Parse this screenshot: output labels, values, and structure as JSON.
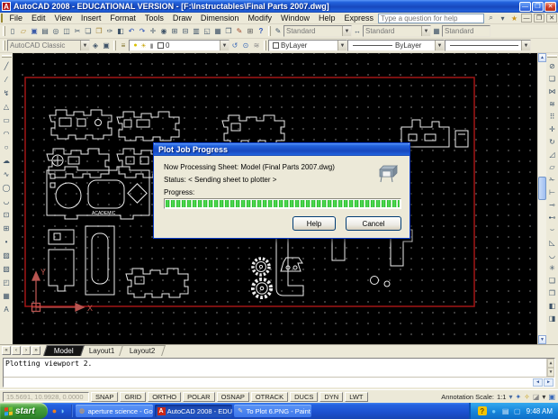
{
  "window": {
    "title": "AutoCAD 2008 - EDUCATIONAL VERSION - [F:\\Instructables\\Final Parts 2007.dwg]",
    "controls": {
      "minimize": "—",
      "restore": "❐",
      "close": "✕"
    }
  },
  "menubar": {
    "items": [
      "File",
      "Edit",
      "View",
      "Insert",
      "Format",
      "Tools",
      "Draw",
      "Dimension",
      "Modify",
      "Window",
      "Help",
      "Express"
    ],
    "help_placeholder": "Type a question for help",
    "icons": [
      {
        "n": "search-icon",
        "g": "⌕"
      },
      {
        "n": "search-dropdown-icon",
        "g": "▾"
      },
      {
        "n": "info-center-star-icon",
        "g": "★",
        "s": "color:#C89018"
      }
    ],
    "mdi": {
      "minimize": "—",
      "restore": "❐",
      "close": "✕"
    }
  },
  "toolbars": {
    "standard": [
      {
        "n": "qnew-icon",
        "g": "▯"
      },
      {
        "n": "open-icon",
        "g": "▱",
        "s": "color:#B08A28"
      },
      {
        "n": "save-icon",
        "g": "▣",
        "s": "color:#3A5AA8"
      },
      {
        "n": "plot-icon",
        "g": "▤"
      },
      {
        "n": "plot-preview-icon",
        "g": "◎"
      },
      {
        "n": "publish-icon",
        "g": "◫"
      },
      {
        "n": "cut-icon",
        "g": "✂"
      },
      {
        "n": "copy-icon",
        "g": "❏"
      },
      {
        "n": "paste-icon",
        "g": "❐",
        "s": "color:#A08030"
      },
      {
        "n": "match-properties-icon",
        "g": "✑"
      },
      {
        "n": "block-editor-icon",
        "g": "◧"
      },
      {
        "n": "undo-icon",
        "g": "↶",
        "s": "color:#2A52B8"
      },
      {
        "n": "redo-icon",
        "g": "↷",
        "s": "color:#2A52B8"
      },
      {
        "n": "pan-icon",
        "g": "✛"
      },
      {
        "n": "zoom-realtime-icon",
        "g": "◉"
      },
      {
        "n": "zoom-window-icon",
        "g": "⊞"
      },
      {
        "n": "zoom-previous-icon",
        "g": "⊟"
      },
      {
        "n": "properties-icon",
        "g": "▥"
      },
      {
        "n": "designcenter-icon",
        "g": "◱"
      },
      {
        "n": "tool-palettes-icon",
        "g": "▦"
      },
      {
        "n": "sheetset-manager-icon",
        "g": "❒"
      },
      {
        "n": "markup-icon",
        "g": "✎",
        "s": "color:#A04828"
      },
      {
        "n": "quickcalc-icon",
        "g": "⊞",
        "s": "color:#555"
      },
      {
        "n": "help-icon",
        "g": "?",
        "s": "color:#2A52B8;font-weight:bold"
      }
    ],
    "styles": {
      "text_style_value": "Standard",
      "dim_style_value": "Standard",
      "table_style_value": "Standard"
    },
    "style_icons": [
      {
        "n": "text-style-icon",
        "g": "✎"
      },
      {
        "n": "dim-style-icon",
        "g": "↔"
      },
      {
        "n": "table-style-icon",
        "g": "▦"
      }
    ],
    "workspace": {
      "value": "AutoCAD Classic"
    },
    "workspace_icons": [
      {
        "n": "workspace-settings-icon",
        "g": "◈"
      },
      {
        "n": "my-workspace-icon",
        "g": "▣"
      }
    ],
    "layers": {
      "properties_icon": {
        "n": "layer-properties-manager-icon",
        "g": "≡",
        "s": "color:#7A6A20"
      },
      "combo_icons": [
        {
          "n": "layer-on-bulb-icon",
          "g": "●",
          "s": "color:#D8C000"
        },
        {
          "n": "layer-freeze-sun-icon",
          "g": "☀",
          "s": "color:#C8A200"
        },
        {
          "n": "layer-lock-icon",
          "g": "▮",
          "s": "color:#8A8A8A"
        }
      ],
      "layer_value": "0",
      "after_icons": [
        {
          "n": "make-object-layer-current-icon",
          "g": "↺",
          "s": "color:#3A6AB8"
        },
        {
          "n": "layer-previous-icon",
          "g": "⊙",
          "s": "color:#3A6AB8"
        },
        {
          "n": "layer-states-icon",
          "g": "≋",
          "s": "color:#888"
        }
      ]
    },
    "properties": {
      "color_value": "ByLayer",
      "linetype_value": "ByLayer"
    }
  },
  "draw_toolbar": [
    {
      "n": "line-icon",
      "g": "╱"
    },
    {
      "n": "construction-line-icon",
      "g": "⁄"
    },
    {
      "n": "polyline-icon",
      "g": "↯"
    },
    {
      "n": "polygon-icon",
      "g": "△"
    },
    {
      "n": "rectangle-icon",
      "g": "▭"
    },
    {
      "n": "arc-icon",
      "g": "◠"
    },
    {
      "n": "circle-icon",
      "g": "○"
    },
    {
      "n": "revision-cloud-icon",
      "g": "☁"
    },
    {
      "n": "spline-icon",
      "g": "∿"
    },
    {
      "n": "ellipse-icon",
      "g": "◯"
    },
    {
      "n": "ellipse-arc-icon",
      "g": "◡"
    },
    {
      "n": "insert-block-icon",
      "g": "⊡"
    },
    {
      "n": "make-block-icon",
      "g": "⊞"
    },
    {
      "n": "point-icon",
      "g": "•"
    },
    {
      "n": "hatch-icon",
      "g": "▨"
    },
    {
      "n": "gradient-icon",
      "g": "▧"
    },
    {
      "n": "region-icon",
      "g": "◰"
    },
    {
      "n": "table-icon",
      "g": "▦"
    },
    {
      "n": "mtext-icon",
      "g": "A"
    }
  ],
  "modify_toolbar": [
    {
      "n": "erase-icon",
      "g": "⊘"
    },
    {
      "n": "copy-object-icon",
      "g": "❏"
    },
    {
      "n": "mirror-icon",
      "g": "⋈"
    },
    {
      "n": "offset-icon",
      "g": "≋"
    },
    {
      "n": "array-icon",
      "g": "⠿"
    },
    {
      "n": "move-icon",
      "g": "✛"
    },
    {
      "n": "rotate-icon",
      "g": "↻"
    },
    {
      "n": "scale-icon",
      "g": "◿"
    },
    {
      "n": "stretch-icon",
      "g": "▱"
    },
    {
      "n": "trim-icon",
      "g": "✁"
    },
    {
      "n": "extend-icon",
      "g": "⊢"
    },
    {
      "n": "break-at-point-icon",
      "g": "⊸"
    },
    {
      "n": "break-icon",
      "g": "⊷"
    },
    {
      "n": "join-icon",
      "g": "⌣"
    },
    {
      "n": "chamfer-icon",
      "g": "◺"
    },
    {
      "n": "fillet-icon",
      "g": "◡"
    },
    {
      "n": "explode-icon",
      "g": "✳"
    },
    {
      "n": "draworder-front-icon",
      "g": "❑"
    },
    {
      "n": "draworder-back-icon",
      "g": "❒"
    },
    {
      "n": "draworder-above-icon",
      "g": "◧"
    },
    {
      "n": "draworder-below-icon",
      "g": "◨"
    }
  ],
  "canvas": {
    "part_text": "ACADEMIC",
    "ucs_x_label": "X",
    "ucs_y_label": "Y"
  },
  "dialog": {
    "title": "Plot Job Progress",
    "processing_line": "Now Processing Sheet: Model (Final Parts 2007.dwg)",
    "status_line": "Status: < Sending sheet to plotter >",
    "progress_label": "Progress:",
    "help_button": "Help",
    "cancel_button": "Cancel"
  },
  "tabs": {
    "nav": [
      "«",
      "‹",
      "›",
      "»"
    ],
    "items": [
      "Model",
      "Layout1",
      "Layout2"
    ]
  },
  "command": {
    "history_line": "Plotting viewport 2.",
    "input_value": ""
  },
  "statusbar": {
    "coordinates": "15.5691, 10.9928, 0.0000",
    "toggles": [
      "SNAP",
      "GRID",
      "ORTHO",
      "POLAR",
      "OSNAP",
      "OTRACK",
      "DUCS",
      "DYN",
      "LWT"
    ],
    "annotation_scale_label": "Annotation Scale:",
    "annotation_scale_value": "1:1",
    "right_icons": [
      {
        "n": "annotation-visibility-icon",
        "g": "✦",
        "s": "color:#3A6AB8"
      },
      {
        "n": "annotation-autoscale-icon",
        "g": "✧",
        "s": "color:#C8A018"
      },
      {
        "n": "toolbar-lock-icon",
        "g": "◪",
        "s": "color:#888"
      },
      {
        "n": "status-tray-menu-icon",
        "g": "▾",
        "s": "color:#333"
      },
      {
        "n": "clean-screen-icon",
        "g": "▣",
        "s": "color:#3A6AB8"
      }
    ]
  },
  "taskbar": {
    "start_label": "start",
    "quick_launch": [
      {
        "n": "browser-quicklaunch-icon",
        "g": "●",
        "s": "color:#F08020"
      },
      {
        "n": "app-quicklaunch-icon",
        "g": "◑",
        "s": "color:#78C8F8"
      }
    ],
    "tasks": [
      {
        "label": "aperture science - Go...",
        "active": false
      },
      {
        "label": "AutoCAD 2008 - EDU...",
        "active": true
      },
      {
        "label": "To Plot 6.PNG - Paint",
        "active": false
      }
    ],
    "tray_icons": [
      {
        "n": "help-alert-tray-icon",
        "g": "?",
        "s": "background:#F4C400;color:#6A4A00;font-weight:bold"
      },
      {
        "n": "update-tray-icon",
        "g": "●",
        "s": "color:#70C8F8"
      },
      {
        "n": "printer-tray-icon",
        "g": "▤",
        "s": "color:#D8E8F8"
      },
      {
        "n": "display-tray-icon",
        "g": "▢",
        "s": "color:#BCD8F8"
      }
    ],
    "clock": "9:48 AM"
  },
  "colors": {
    "titlebar_blue": "#1748BE",
    "plot_area_red": "#A31515",
    "progress_green": "#1FB322",
    "canvas_black": "#000000"
  }
}
